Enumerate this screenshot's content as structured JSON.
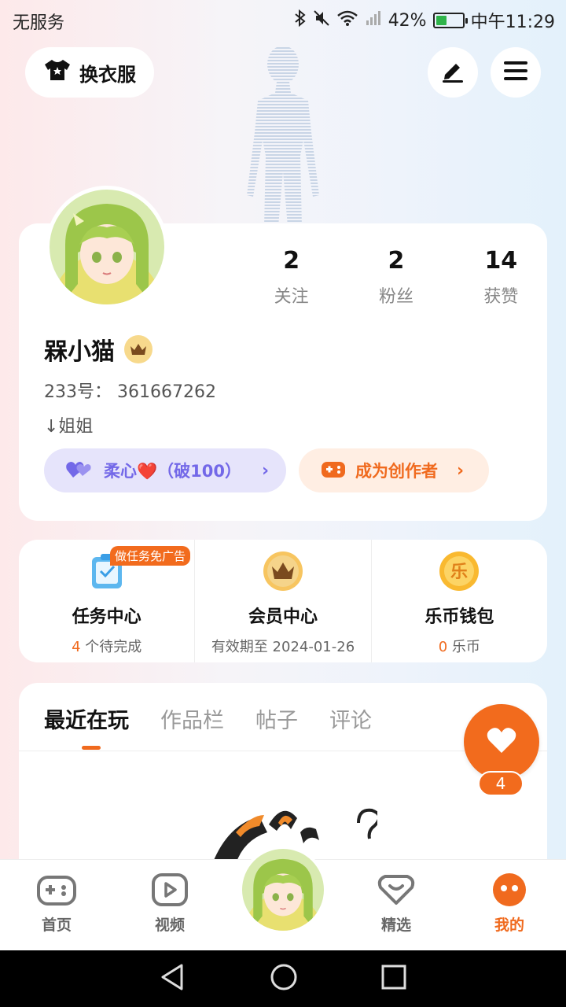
{
  "status_bar": {
    "carrier": "无服务",
    "battery": "42%",
    "battery_level": 0.42,
    "time": "中午11:29"
  },
  "header": {
    "dress_label": "换衣服"
  },
  "profile": {
    "stats": [
      {
        "num": "2",
        "label": "关注"
      },
      {
        "num": "2",
        "label": "粉丝"
      },
      {
        "num": "14",
        "label": "获赞"
      }
    ],
    "name": "槑小猫",
    "uid": "233号： 361667262",
    "bio": "↓姐姐",
    "pill_purple": "柔心❤️（破100）",
    "pill_orange": "成为创作者"
  },
  "services": {
    "task": {
      "title": "任务中心",
      "badge": "做任务免广告",
      "count": "4",
      "suffix": " 个待完成"
    },
    "vip": {
      "title": "会员中心",
      "sub": "有效期至 2024-01-26"
    },
    "wallet": {
      "title": "乐币钱包",
      "count": "0",
      "suffix": " 乐币",
      "icon_char": "乐"
    }
  },
  "tabs": [
    "最近在玩",
    "作品栏",
    "帖子",
    "评论"
  ],
  "favorite": {
    "count": "4"
  },
  "bottom_nav": {
    "home": "首页",
    "video": "视频",
    "featured": "精选",
    "mine": "我的"
  },
  "colors": {
    "accent": "#f06a1e",
    "purple": "#7368e8"
  }
}
